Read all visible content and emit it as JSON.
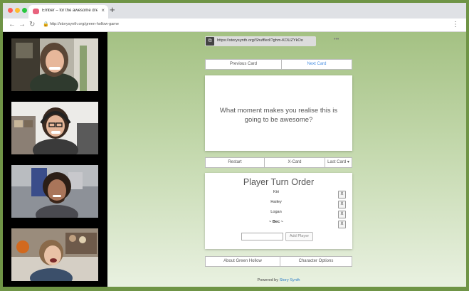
{
  "browser": {
    "tab_title": "Ember – for the awesome dren...",
    "tab_close": "×",
    "new_tab": "+",
    "address": "http://storysynth.org/green-hollow-game",
    "nav": {
      "back": "←",
      "forward": "→",
      "reload": "↻"
    },
    "lock": "🔒",
    "menu": "⋮"
  },
  "app": {
    "share_url": "https://storysynth.org/Shuffled/?ghm-KOUZYkOo",
    "copy_icon": "⧉",
    "more_icon": "•••",
    "card_nav": {
      "previous": "Previous Card",
      "next": "Next Card"
    },
    "card": {
      "text": "What moment makes you realise this is going to be awesome?"
    },
    "controls": {
      "restart": "Restart",
      "xcard": "X-Card",
      "lastcard": "Last Card ▾"
    },
    "player_panel": {
      "title": "Player Turn Order",
      "players": [
        {
          "name": "Kiri",
          "current": false
        },
        {
          "name": "Hailey",
          "current": false
        },
        {
          "name": "Logan",
          "current": false
        },
        {
          "name": "~ Bec ~",
          "current": true
        }
      ],
      "remove_label": "X",
      "add_placeholder": "",
      "add_button": "Add Player"
    },
    "bottom_nav": {
      "about": "About Green Hollow",
      "options": "Character Options"
    },
    "footer": {
      "powered_by": "Powered by",
      "link": "Story Synth"
    }
  },
  "colors": {
    "frame": "#6f9446",
    "accent_link": "#4a90e2",
    "gradient_top": "#a4c183",
    "gradient_bottom": "#e9f1e1"
  }
}
